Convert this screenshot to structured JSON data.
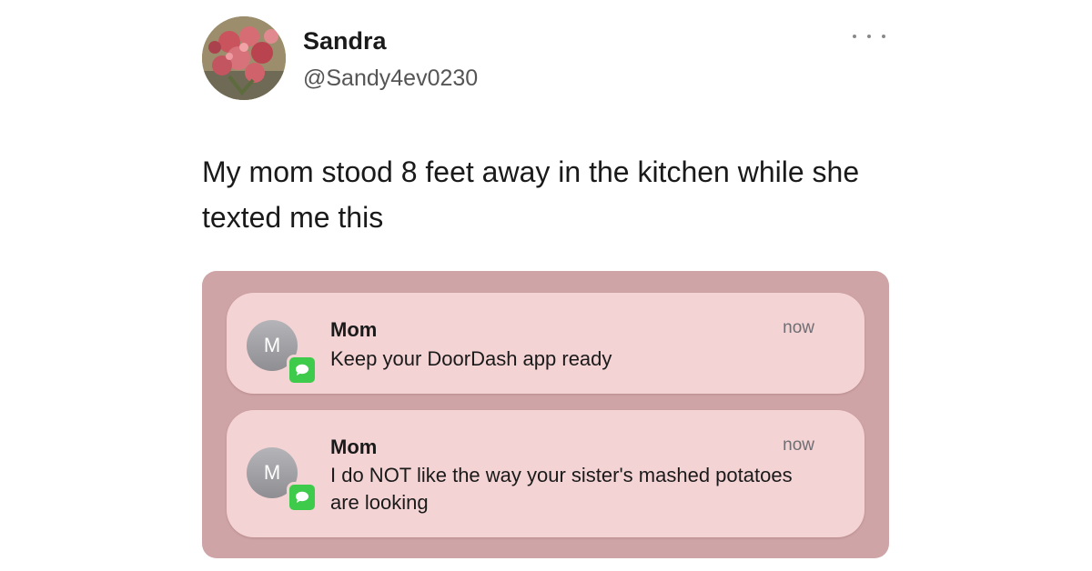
{
  "tweet": {
    "author": {
      "display_name": "Sandra",
      "handle": "@Sandy4ev0230",
      "avatar_icon": "flower-bouquet-avatar"
    },
    "more_icon": "more-options-icon",
    "text": "My mom stood 8 feet away in the kitchen while she texted me this"
  },
  "screenshot": {
    "background_color": "#cfa4a6",
    "card_color": "#f4d3d4",
    "notifications": [
      {
        "avatar_initial": "M",
        "app_icon": "messages-icon",
        "sender": "Mom",
        "message": "Keep your DoorDash app ready",
        "time": "now"
      },
      {
        "avatar_initial": "M",
        "app_icon": "messages-icon",
        "sender": "Mom",
        "message": "I do NOT like the way your sister's mashed potatoes are looking",
        "time": "now"
      }
    ]
  }
}
